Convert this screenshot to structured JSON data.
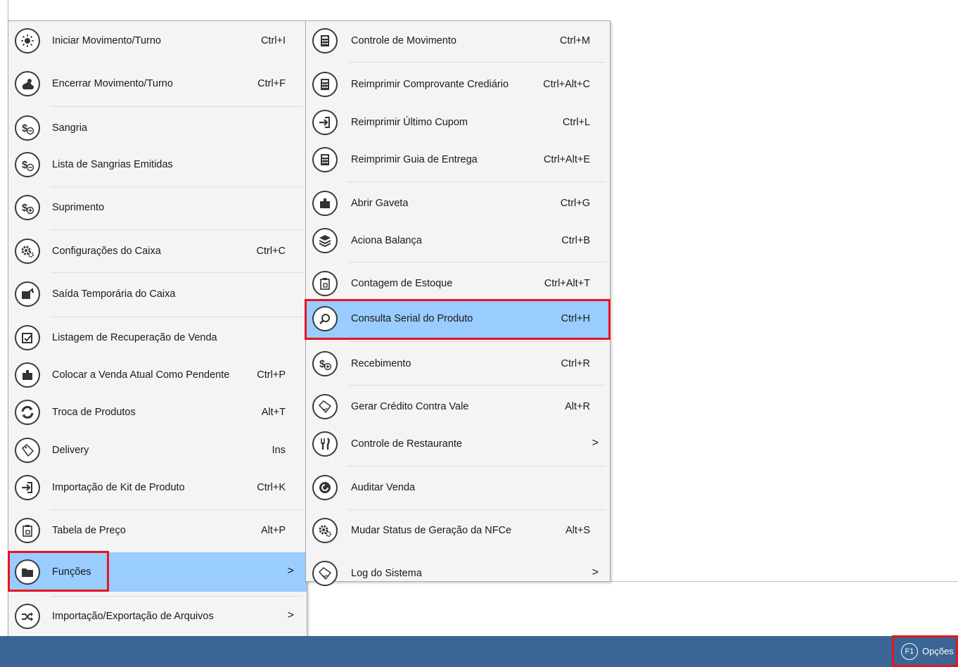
{
  "main_menu": {
    "items": [
      {
        "label": "Iniciar Movimento/Turno",
        "shortcut": "Ctrl+I",
        "icon": "sun-icon"
      },
      {
        "label": "Encerrar Movimento/Turno",
        "shortcut": "Ctrl+F",
        "icon": "cloud-sun-icon"
      },
      {
        "label": "Sangria",
        "shortcut": "",
        "icon": "money-minus-icon"
      },
      {
        "label": "Lista de Sangrias Emitidas",
        "shortcut": "",
        "icon": "money-minus-icon"
      },
      {
        "label": "Suprimento",
        "shortcut": "",
        "icon": "money-plus-icon"
      },
      {
        "label": "Configurações do Caixa",
        "shortcut": "Ctrl+C",
        "icon": "gears-icon"
      },
      {
        "label": "Saída Temporária do Caixa",
        "shortcut": "",
        "icon": "exit-icon"
      },
      {
        "label": "Listagem de Recuperação de Venda",
        "shortcut": "",
        "icon": "edit-list-icon"
      },
      {
        "label": "Colocar a Venda Atual Como Pendente",
        "shortcut": "Ctrl+P",
        "icon": "drawer-icon"
      },
      {
        "label": "Troca de Produtos",
        "shortcut": "Alt+T",
        "icon": "swap-icon"
      },
      {
        "label": "Delivery",
        "shortcut": "Ins",
        "icon": "tag-icon"
      },
      {
        "label": "Importação de Kit de Produto",
        "shortcut": "Ctrl+K",
        "icon": "import-icon"
      },
      {
        "label": "Tabela de Preço",
        "shortcut": "Alt+P",
        "icon": "clipboard-icon"
      },
      {
        "label": "Funções",
        "shortcut": "",
        "icon": "folder-icon",
        "arrow": ">"
      },
      {
        "label": "Importação/Exportação de Arquivos",
        "shortcut": "",
        "icon": "shuffle-icon",
        "arrow": ">"
      }
    ]
  },
  "sub_menu": {
    "items": [
      {
        "label": "Controle de Movimento",
        "shortcut": "Ctrl+M",
        "icon": "calculator-icon"
      },
      {
        "label": "Reimprimir Comprovante Crediário",
        "shortcut": "Ctrl+Alt+C",
        "icon": "calculator-icon"
      },
      {
        "label": "Reimprimir Último Cupom",
        "shortcut": "Ctrl+L",
        "icon": "import-icon"
      },
      {
        "label": "Reimprimir Guia de Entrega",
        "shortcut": "Ctrl+Alt+E",
        "icon": "calculator-icon"
      },
      {
        "label": "Abrir Gaveta",
        "shortcut": "Ctrl+G",
        "icon": "drawer-icon"
      },
      {
        "label": "Aciona Balança",
        "shortcut": "Ctrl+B",
        "icon": "layers-icon"
      },
      {
        "label": "Contagem de Estoque",
        "shortcut": "Ctrl+Alt+T",
        "icon": "clipboard-icon"
      },
      {
        "label": "Consulta Serial do Produto",
        "shortcut": "Ctrl+H",
        "icon": "search-icon"
      },
      {
        "label": "Recebimento",
        "shortcut": "Ctrl+R",
        "icon": "money-plus-icon"
      },
      {
        "label": "Gerar Crédito Contra Vale",
        "shortcut": "Alt+R",
        "icon": "tag-icon"
      },
      {
        "label": "Controle de Restaurante",
        "shortcut": "",
        "icon": "cutlery-icon",
        "arrow": ">"
      },
      {
        "label": "Auditar Venda",
        "shortcut": "",
        "icon": "audit-icon"
      },
      {
        "label": "Mudar Status de Geração da NFCe",
        "shortcut": "Alt+S",
        "icon": "gears-icon"
      },
      {
        "label": "Log do Sistema",
        "shortcut": "",
        "icon": "tag-icon",
        "arrow": ">"
      }
    ]
  },
  "taskbar": {
    "f1_key": "F1",
    "options_label": "Opções"
  },
  "colors": {
    "highlight": "#99ccff",
    "taskbar": "#3a6594",
    "annotation": "#e8141e"
  }
}
